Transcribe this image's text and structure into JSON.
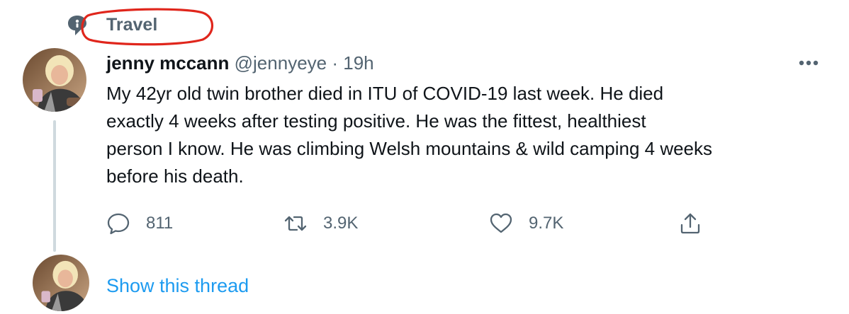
{
  "topic": {
    "label": "Travel",
    "icon": "topic-speech-bubble-icon"
  },
  "tweet": {
    "author_name": "jenny mccann",
    "handle": "@jennyeye",
    "separator": "·",
    "timestamp": "19h",
    "text": "My 42yr old twin brother died in ITU of COVID-19 last week. He died\nexactly 4 weeks after testing positive. He was the fittest, healthiest\nperson I know. He was climbing Welsh mountains & wild camping 4 weeks\nbefore his death.",
    "actions": {
      "reply_count": "811",
      "retweet_count": "3.9K",
      "like_count": "9.7K"
    }
  },
  "thread": {
    "show_label": "Show this thread"
  },
  "colors": {
    "text": "#0f1419",
    "secondary": "#536471",
    "link": "#1d9bf0",
    "annotation": "#e0261c"
  }
}
